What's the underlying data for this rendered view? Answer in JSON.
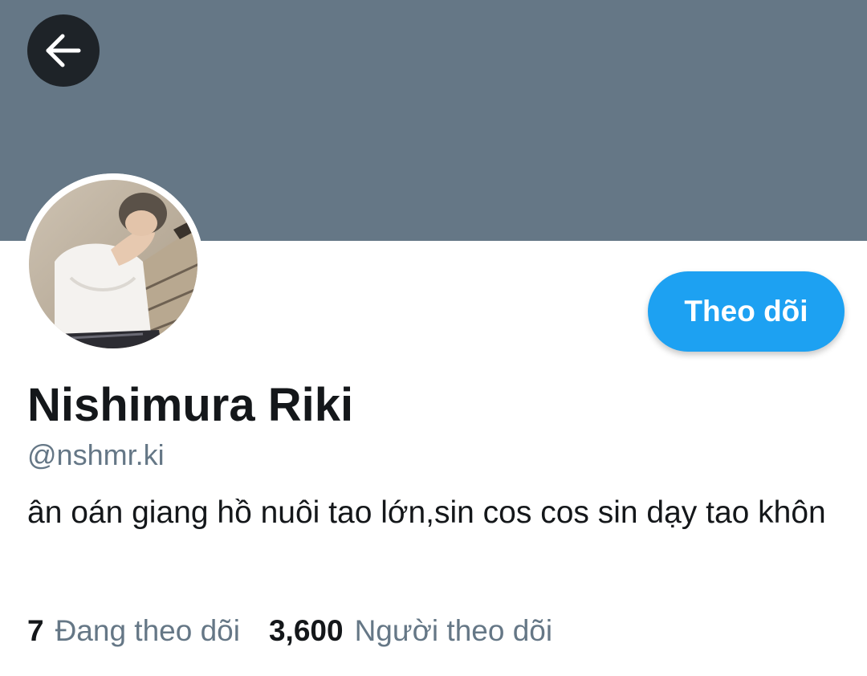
{
  "header": {
    "banner_color": "#657786",
    "back_icon": "arrow-left-icon"
  },
  "profile": {
    "avatar_description": "profile-photo",
    "display_name": "Nishimura Riki",
    "handle": "@nshmr.ki",
    "bio": "ân oán giang hồ nuôi tao lớn,sin cos cos sin dạy tao khôn",
    "follow_button_label": "Theo dõi",
    "accent_color": "#1da1f2"
  },
  "stats": {
    "following_count": "7",
    "following_label": "Đang theo dõi",
    "followers_count": "3,600",
    "followers_label": "Người theo dõi"
  }
}
